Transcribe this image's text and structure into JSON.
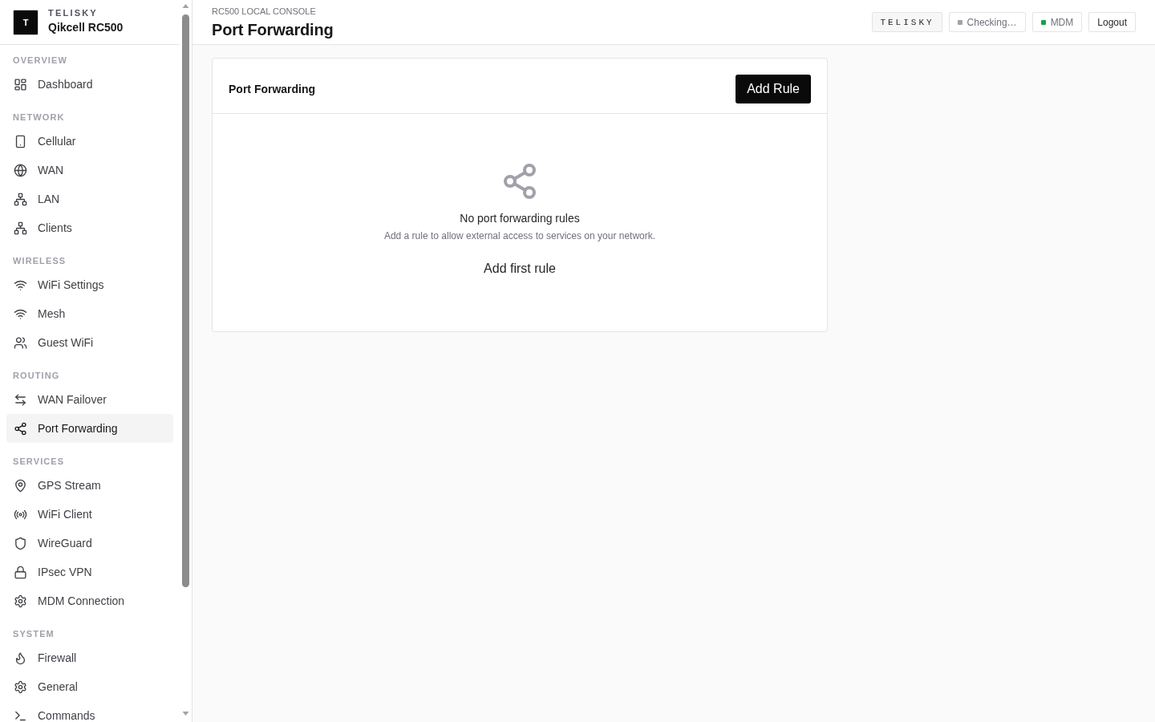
{
  "sidebar": {
    "brand": {
      "logo_letter": "T",
      "company": "TELISKY",
      "product": "Qikcell RC500"
    },
    "sections": [
      {
        "title": "OVERVIEW",
        "items": [
          {
            "label": "Dashboard",
            "selected": false
          }
        ]
      },
      {
        "title": "NETWORK",
        "items": [
          {
            "label": "Cellular",
            "selected": false
          },
          {
            "label": "WAN",
            "selected": false
          },
          {
            "label": "LAN",
            "selected": false
          },
          {
            "label": "Clients",
            "selected": false
          }
        ]
      },
      {
        "title": "WIRELESS",
        "items": [
          {
            "label": "WiFi Settings",
            "selected": false
          },
          {
            "label": "Mesh",
            "selected": false
          },
          {
            "label": "Guest WiFi",
            "selected": false
          }
        ]
      },
      {
        "title": "ROUTING",
        "items": [
          {
            "label": "WAN Failover",
            "selected": false
          },
          {
            "label": "Port Forwarding",
            "selected": true
          }
        ]
      },
      {
        "title": "SERVICES",
        "items": [
          {
            "label": "GPS Stream",
            "selected": false
          },
          {
            "label": "WiFi Client",
            "selected": false
          },
          {
            "label": "WireGuard",
            "selected": false
          },
          {
            "label": "IPsec VPN",
            "selected": false
          },
          {
            "label": "MDM Connection",
            "selected": false
          }
        ]
      },
      {
        "title": "SYSTEM",
        "items": [
          {
            "label": "Firewall",
            "selected": false
          },
          {
            "label": "General",
            "selected": false
          },
          {
            "label": "Commands",
            "selected": false
          }
        ]
      }
    ]
  },
  "header": {
    "eyebrow": "RC500 LOCAL CONSOLE",
    "title": "Port Forwarding",
    "brand_badge": "TELISKY",
    "status_badges": [
      {
        "label": "Checking…",
        "color": "#a1a1aa"
      },
      {
        "label": "MDM",
        "color": "#16a34a"
      }
    ],
    "logout": "Logout"
  },
  "card": {
    "title": "Port Forwarding",
    "add_button": "Add Rule",
    "empty_state": {
      "title": "No port forwarding rules",
      "description": "Add a rule to allow external access to services on your network.",
      "action": "Add first rule"
    }
  }
}
